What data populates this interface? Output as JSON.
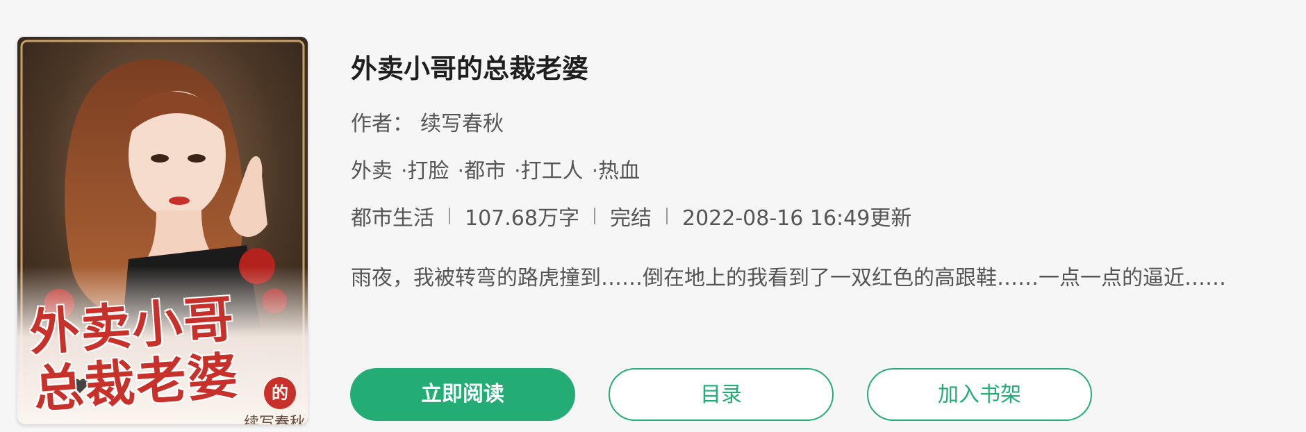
{
  "book": {
    "title": "外卖小哥的总裁老婆",
    "author_label": "作者：",
    "author": "续写春秋",
    "tags": [
      "外卖",
      "·打脸",
      "·都市",
      "·打工人",
      "·热血"
    ],
    "category": "都市生活",
    "word_count": "107.68万字",
    "status": "完结",
    "updated": "2022-08-16 16:49更新",
    "description": "雨夜，我被转弯的路虎撞到……倒在地上的我看到了一双红色的高跟鞋……一点一点的逼近……"
  },
  "cover": {
    "title_line1": "外卖小哥",
    "title_line2": "总裁老婆",
    "de": "的",
    "author": "续写春秋"
  },
  "actions": {
    "read_label": "立即阅读",
    "toc_label": "目录",
    "shelf_label": "加入书架"
  },
  "colors": {
    "accent": "#23ad75",
    "cover_title": "#c8302a"
  }
}
